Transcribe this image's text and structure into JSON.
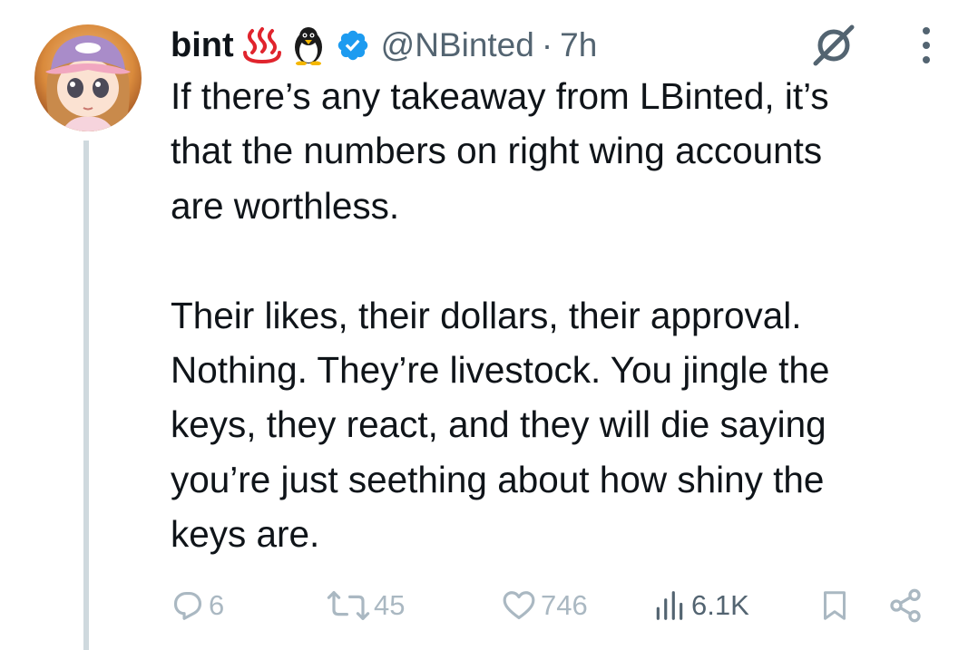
{
  "tweet": {
    "author": {
      "display_name": "bint",
      "emojis": [
        "hot-springs-emoji",
        "penguin-emoji"
      ],
      "handle": "@NBinted",
      "separator": "·",
      "time": "7h",
      "verified": true
    },
    "paragraphs": [
      "If there’s any takeaway from LBinted, it’s\nthat the numbers on right wing accounts\nare worthless.",
      "Their likes, their dollars, their approval.\nNothing. They’re livestock. You jingle the\nkeys, they react, and they will die saying\nyou’re just seething about how shiny the\nkeys are."
    ],
    "actions": {
      "replies": "6",
      "reposts": "45",
      "likes": "746",
      "views": "6.1K"
    },
    "icons": {
      "reply": "reply-icon",
      "repost": "repost-icon",
      "like": "heart-icon",
      "views": "views-bar-chart-icon",
      "bookmark": "bookmark-icon",
      "share": "share-icon",
      "grok": "grok-icon",
      "more": "more-vertical-icon"
    },
    "colors": {
      "text": "#0f1419",
      "muted": "#536471",
      "action_faded": "#aab8c2",
      "verified": "#1d9bf0",
      "thread_line": "#cfd9de"
    }
  }
}
